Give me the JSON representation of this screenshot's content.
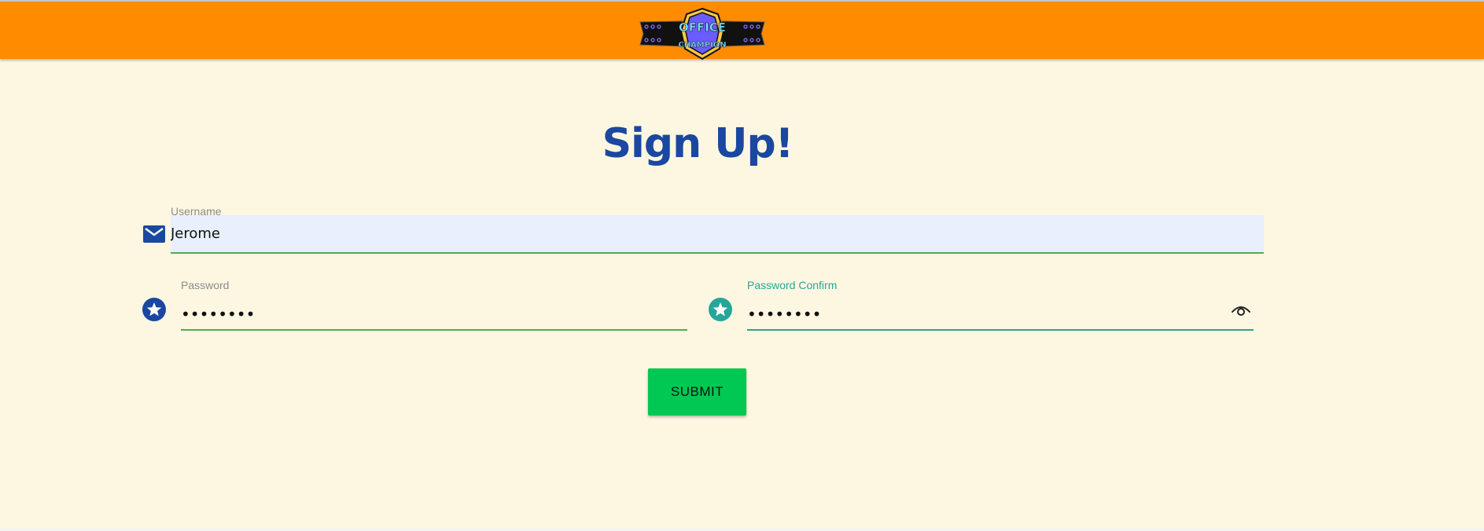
{
  "header": {
    "logo": {
      "icon": "championship-belt-logo",
      "top_text": "OFFICE",
      "bottom_text": "CHAMPION"
    }
  },
  "page": {
    "title": "Sign Up!"
  },
  "form": {
    "username": {
      "label": "Username",
      "value": "Jerome",
      "icon": "envelope-icon"
    },
    "password": {
      "label": "Password",
      "value": "••••••••",
      "icon": "star-icon"
    },
    "password_confirm": {
      "label": "Password Confirm",
      "value": "••••••••",
      "icon": "star-icon",
      "toggle_icon": "eye-icon"
    },
    "submit_label": "SUBMIT"
  },
  "colors": {
    "header_bg": "#ff8c00",
    "page_bg": "#fdf7e1",
    "title": "#1a47a0",
    "input_line": "#4caf50",
    "active_accent": "#26a69a",
    "submit_bg": "#00c853"
  }
}
